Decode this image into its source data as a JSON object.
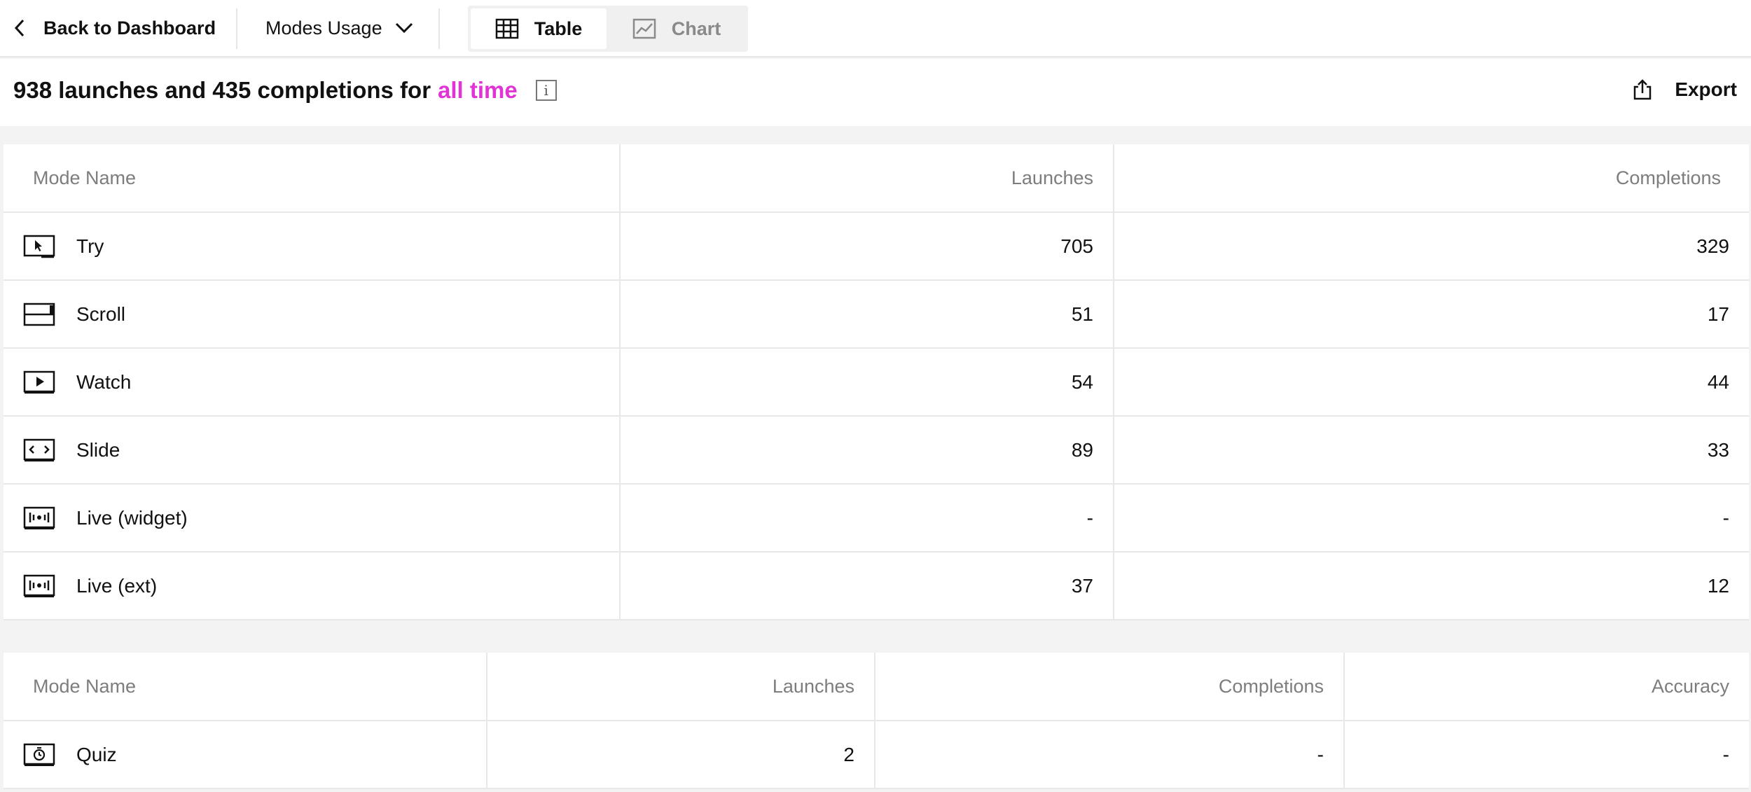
{
  "nav": {
    "back_label": "Back to Dashboard",
    "report_selector": "Modes Usage",
    "view_toggle": {
      "table_label": "Table",
      "chart_label": "Chart",
      "active": "Table"
    }
  },
  "summary": {
    "text": "938 launches and 435 completions for",
    "period": "all time"
  },
  "export_label": "Export",
  "table1": {
    "headers": [
      "Mode Name",
      "Launches",
      "Completions"
    ],
    "rows": [
      {
        "icon": "try-mode-icon",
        "name": "Try",
        "launches": "705",
        "completions": "329"
      },
      {
        "icon": "scroll-mode-icon",
        "name": "Scroll",
        "launches": "51",
        "completions": "17"
      },
      {
        "icon": "watch-mode-icon",
        "name": "Watch",
        "launches": "54",
        "completions": "44"
      },
      {
        "icon": "slide-mode-icon",
        "name": "Slide",
        "launches": "89",
        "completions": "33"
      },
      {
        "icon": "live-mode-icon",
        "name": "Live (widget)",
        "launches": "-",
        "completions": "-"
      },
      {
        "icon": "live-mode-icon",
        "name": "Live (ext)",
        "launches": "37",
        "completions": "12"
      }
    ]
  },
  "table2": {
    "headers": [
      "Mode Name",
      "Launches",
      "Completions",
      "Accuracy"
    ],
    "rows": [
      {
        "icon": "quiz-mode-icon",
        "name": "Quiz",
        "launches": "2",
        "completions": "-",
        "accuracy": "-"
      }
    ]
  },
  "colors": {
    "accent": "#e034d5",
    "muted": "#7d7d7d",
    "border": "#e8e8e8",
    "page_bg": "#f3f3f3"
  }
}
